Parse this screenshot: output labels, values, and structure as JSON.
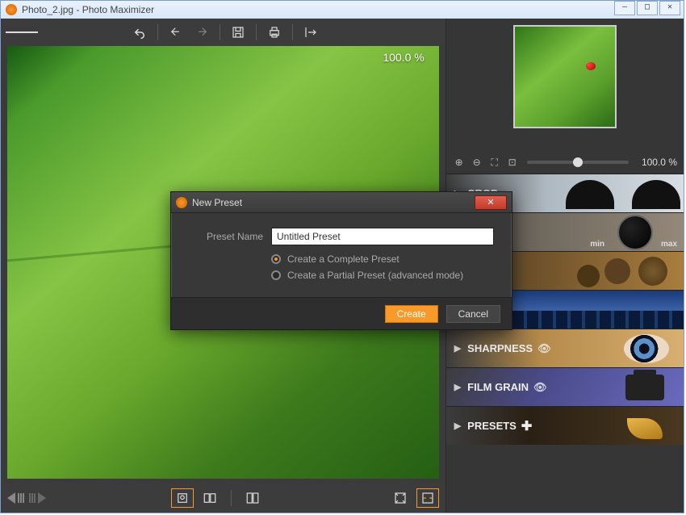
{
  "window": {
    "title": "Photo_2.jpg - Photo Maximizer",
    "minimize": "—",
    "maximize": "□",
    "close": "✕"
  },
  "canvas": {
    "zoom": "100.0 %"
  },
  "preview": {
    "zoom": "100.0 %"
  },
  "panels": {
    "crop": "CROP",
    "dial": "",
    "dial_min": "min",
    "dial_max": "max",
    "gears": "",
    "city": "",
    "sharpness": "SHARPNESS",
    "film_grain": "FILM GRAIN",
    "presets": "PRESETS"
  },
  "dialog": {
    "title": "New Preset",
    "name_label": "Preset Name",
    "name_value": "Untitled Preset",
    "opt_complete": "Create a Complete Preset",
    "opt_partial": "Create a Partial Preset (advanced mode)",
    "create": "Create",
    "cancel": "Cancel"
  }
}
